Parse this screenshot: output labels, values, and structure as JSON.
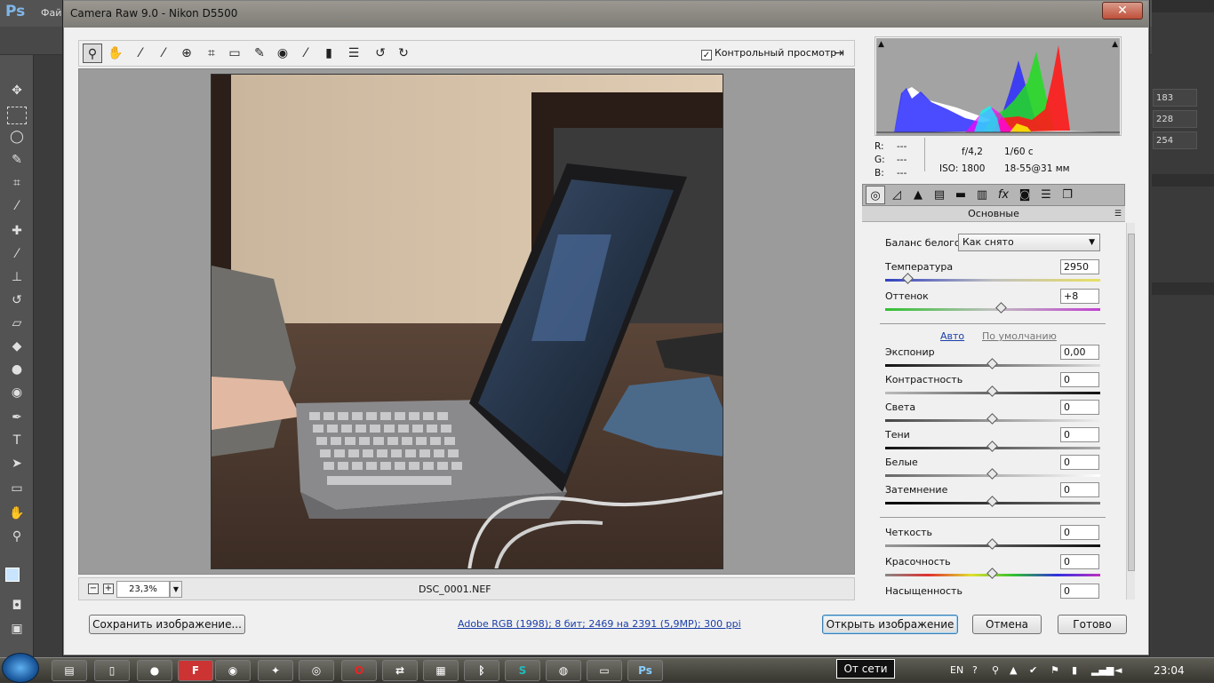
{
  "photoshop": {
    "logo": "Ps",
    "menu_fragment": "Фай",
    "right_values": [
      "183",
      "228",
      "254"
    ]
  },
  "dialog": {
    "title": "Camera Raw 9.0  -  Nikon D5500",
    "close_label": "✕",
    "preview_label": "Контрольный просмотр",
    "preview_checked": true,
    "tools": [
      "zoom-icon",
      "hand-icon",
      "white-balance-icon",
      "color-sampler-icon",
      "targeted-adjust-icon",
      "crop-icon",
      "straighten-icon",
      "spot-removal-icon",
      "red-eye-icon",
      "adjustment-brush-icon",
      "graduated-filter-icon",
      "preferences-icon",
      "rotate-left-icon",
      "rotate-right-icon"
    ],
    "zoom_value": "23,3%",
    "filename": "DSC_0001.NEF",
    "workflow_link": "Adobe RGB (1998); 8 бит; 2469 на 2391 (5,9MP); 300 ppi",
    "buttons": {
      "save": "Сохранить изображение...",
      "open": "Открыть изображение",
      "cancel": "Отмена",
      "done": "Готово"
    }
  },
  "info": {
    "r_label": "R:",
    "g_label": "G:",
    "b_label": "B:",
    "r": "---",
    "g": "---",
    "b": "---",
    "aperture": "f/4,2",
    "shutter": "1/60 с",
    "iso": "ISO: 1800",
    "lens": "18-55@31 мм"
  },
  "panel": {
    "title": "Основные",
    "white_balance_label": "Баланс белого:",
    "white_balance_value": "Как снято",
    "temperature_label": "Температура",
    "temperature": "2950",
    "tint_label": "Оттенок",
    "tint": "+8",
    "auto_label": "Авто",
    "default_label": "По умолчанию",
    "sliders": [
      {
        "label": "Экспонир",
        "value": "0,00"
      },
      {
        "label": "Контрастность",
        "value": "0"
      },
      {
        "label": "Света",
        "value": "0"
      },
      {
        "label": "Тени",
        "value": "0"
      },
      {
        "label": "Белые",
        "value": "0"
      },
      {
        "label": "Затемнение",
        "value": "0"
      }
    ],
    "presence": [
      {
        "label": "Четкость",
        "value": "0"
      },
      {
        "label": "Красочность",
        "value": "0"
      },
      {
        "label": "Насыщенность",
        "value": "0"
      }
    ]
  },
  "taskbar": {
    "tooltip": "От сети",
    "language": "EN",
    "clock": "23:04"
  },
  "colors": {
    "link": "#1a3ea8",
    "histogram_bg": "#a3a3a3"
  }
}
